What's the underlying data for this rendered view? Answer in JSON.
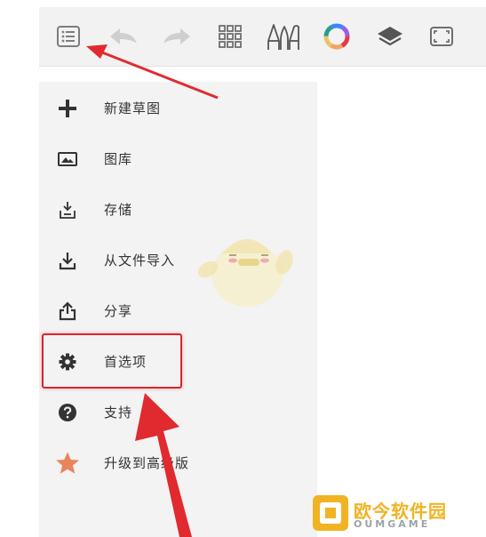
{
  "toolbar": {
    "buttons": [
      {
        "icon": "list-menu-icon"
      },
      {
        "icon": "undo-arrow-icon"
      },
      {
        "icon": "redo-arrow-icon"
      },
      {
        "icon": "grid-icon"
      },
      {
        "icon": "pen-tools-icon"
      },
      {
        "icon": "color-wheel-icon"
      },
      {
        "icon": "layers-icon"
      },
      {
        "icon": "fullscreen-icon"
      }
    ]
  },
  "menu": {
    "items": [
      {
        "label": "新建草图",
        "icon": "plus-icon"
      },
      {
        "label": "图库",
        "icon": "gallery-icon"
      },
      {
        "label": "存储",
        "icon": "save-icon"
      },
      {
        "label": "从文件导入",
        "icon": "import-download-icon"
      },
      {
        "label": "分享",
        "icon": "share-icon"
      },
      {
        "label": "首选项",
        "icon": "gear-icon"
      },
      {
        "label": "支持",
        "icon": "help-icon"
      },
      {
        "label": "升级到高级版",
        "icon": "star-icon"
      }
    ]
  },
  "annotations": {
    "highlight_color": "#d9262e",
    "arrow_color": "#e12a2f"
  },
  "watermark": {
    "text": "欧今软件园",
    "subtext": "OUMGAME",
    "color": "#f0b323"
  }
}
